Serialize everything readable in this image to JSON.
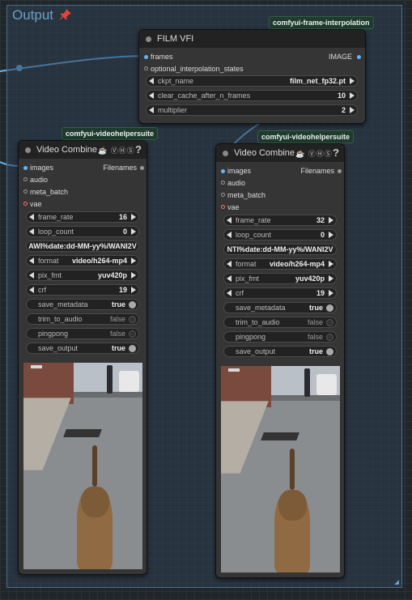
{
  "group": {
    "title": "Output"
  },
  "badges": {
    "film_vfi": "comfyui-frame-interpolation",
    "vc1": "comfyui-videohelpersuite",
    "vc2": "comfyui-videohelpersuite"
  },
  "film_vfi": {
    "title": "FILM VFI",
    "inputs": [
      "frames",
      "optional_interpolation_states"
    ],
    "output": "IMAGE",
    "widgets": [
      {
        "label": "ckpt_name",
        "value": "film_net_fp32.pt"
      },
      {
        "label": "clear_cache_after_n_frames",
        "value": "10"
      },
      {
        "label": "multiplier",
        "value": "2"
      }
    ]
  },
  "vc1": {
    "title": "Video Combine",
    "icons": "☕ ⓋⒽⓈ",
    "help": "?",
    "inputs": [
      "images",
      "audio",
      "meta_batch",
      "vae"
    ],
    "output": "Filenames",
    "frame_rate": "16",
    "loop_count": "0",
    "prefix": "AWI%date:dd-MM-yy%/WANI2V",
    "format": "video/h264-mp4",
    "pix_fmt": "yuv420p",
    "crf": "19",
    "save_metadata": "true",
    "trim_to_audio": "false",
    "pingpong": "false",
    "save_output": "true"
  },
  "vc2": {
    "title": "Video Combine",
    "icons": "☕ ⓋⒽⓈ",
    "help": "?",
    "inputs": [
      "images",
      "audio",
      "meta_batch",
      "vae"
    ],
    "output": "Filenames",
    "frame_rate": "32",
    "loop_count": "0",
    "prefix": "NTI%date:dd-MM-yy%/WANI2V",
    "format": "video/h264-mp4",
    "pix_fmt": "yuv420p",
    "crf": "19",
    "save_metadata": "true",
    "trim_to_audio": "false",
    "pingpong": "false",
    "save_output": "true"
  },
  "labels": {
    "frame_rate": "frame_rate",
    "loop_count": "loop_count",
    "format": "format",
    "pix_fmt": "pix_fmt",
    "crf": "crf",
    "save_metadata": "save_metadata",
    "trim_to_audio": "trim_to_audio",
    "pingpong": "pingpong",
    "save_output": "save_output"
  },
  "colors": {
    "group_border": "#4a6d8c",
    "images_slot": "#64b5f6",
    "vae_slot": "#ff6e6e",
    "badge_bg": "#1f3a2e"
  },
  "icons": {
    "pin": "pushpin-icon"
  }
}
